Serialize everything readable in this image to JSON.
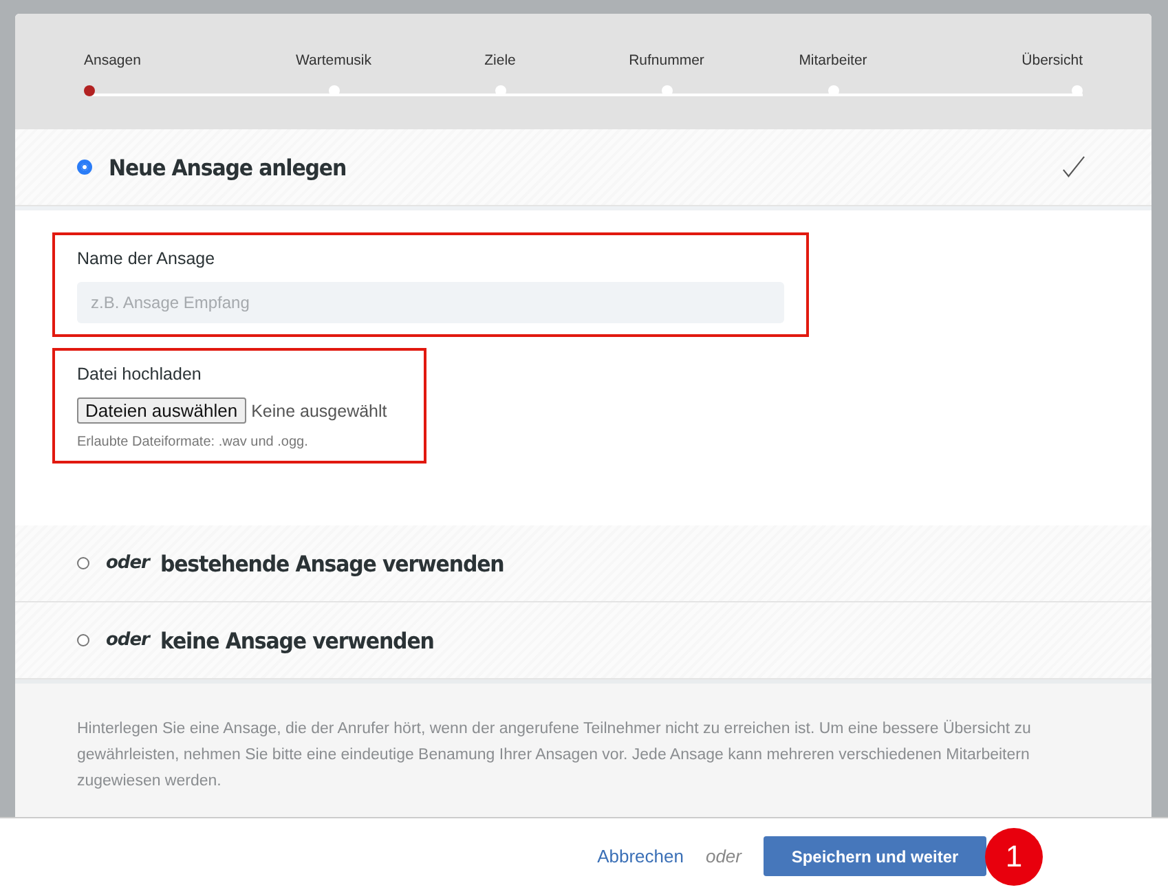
{
  "steps": [
    {
      "label": "Ansagen",
      "selected": true
    },
    {
      "label": "Wartemusik",
      "selected": false
    },
    {
      "label": "Ziele",
      "selected": false
    },
    {
      "label": "Rufnummer",
      "selected": false
    },
    {
      "label": "Mitarbeiter",
      "selected": false
    },
    {
      "label": "Übersicht",
      "selected": false
    }
  ],
  "options": [
    {
      "label": "Neue Ansage anlegen",
      "selected": true,
      "expanded": true
    },
    {
      "prefix": "oder",
      "label": "bestehende Ansage verwenden",
      "selected": false,
      "expanded": false
    },
    {
      "prefix": "oder",
      "label": "keine Ansage verwenden",
      "selected": false,
      "expanded": false
    }
  ],
  "form": {
    "name_field": {
      "label": "Name der Ansage",
      "placeholder": "z.B. Ansage Empfang",
      "highlighted": true
    },
    "upload": {
      "label": "Datei hochladen",
      "button": "Dateien auswählen",
      "status": "Keine ausgewählt",
      "hint": "Erlaubte Dateiformate: .wav und .ogg.",
      "highlighted": true
    }
  },
  "description": "Hinterlegen Sie eine Ansage, die der Anrufer hört, wenn der angerufene Teilnehmer nicht zu erreichen ist. Um eine bessere Übersicht zu gewährleisten, nehmen Sie bitte eine eindeutige Benamung Ihrer Ansagen vor. Jede Ansage kann mehreren verschiedenen Mitarbeitern zugewiesen werden.",
  "footer": {
    "cancel": "Abbrechen",
    "separator": "oder",
    "submit": "Speichern und weiter",
    "badge": "1"
  }
}
